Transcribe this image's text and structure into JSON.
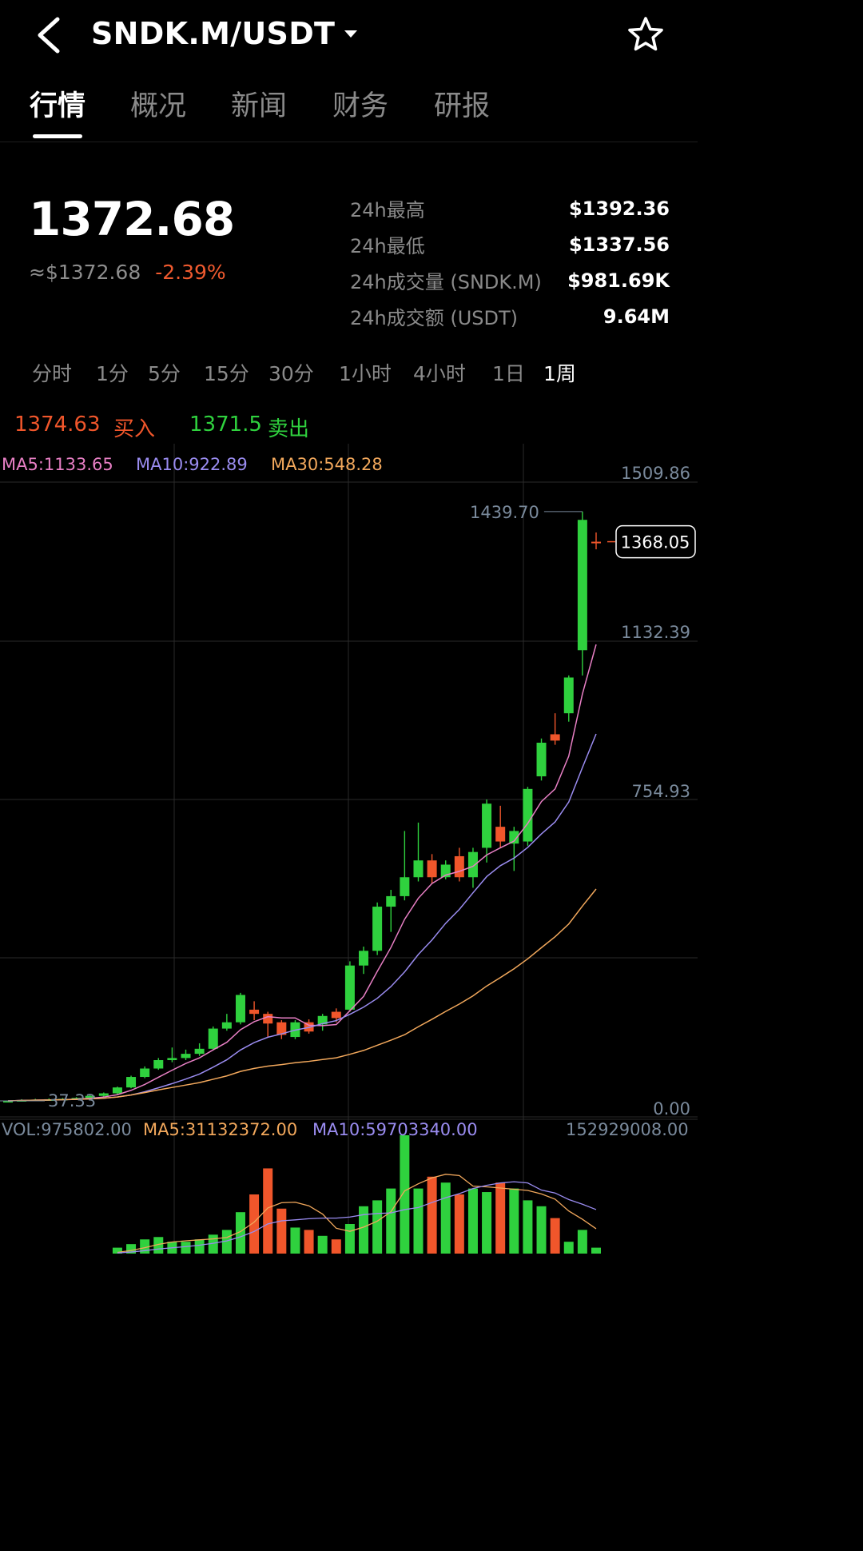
{
  "header": {
    "pair": "SNDK.M/USDT"
  },
  "tabs": [
    {
      "label": "行情",
      "active": true
    },
    {
      "label": "概况",
      "active": false
    },
    {
      "label": "新闻",
      "active": false
    },
    {
      "label": "财务",
      "active": false
    },
    {
      "label": "研报",
      "active": false
    }
  ],
  "price": {
    "last": "1372.68",
    "approx_usd": "≈$1372.68",
    "change_pct": "-2.39%"
  },
  "stats": [
    {
      "label": "24h最高",
      "value": "$1392.36"
    },
    {
      "label": "24h最低",
      "value": "$1337.56"
    },
    {
      "label": "24h成交量 (SNDK.M)",
      "value": "$981.69K"
    },
    {
      "label": "24h成交额 (USDT)",
      "value": "9.64M"
    }
  ],
  "intervals": [
    {
      "label": "分时",
      "active": false
    },
    {
      "label": "1分",
      "active": false
    },
    {
      "label": "5分",
      "active": false
    },
    {
      "label": "15分",
      "active": false
    },
    {
      "label": "30分",
      "active": false
    },
    {
      "label": "1小时",
      "active": false
    },
    {
      "label": "4小时",
      "active": false
    },
    {
      "label": "1日",
      "active": false
    },
    {
      "label": "1周",
      "active": true
    }
  ],
  "orderbook": {
    "bid_price": "1374.63",
    "bid_label": "买入",
    "ask_price": "1371.5",
    "ask_label": "卖出"
  },
  "ma_legend": {
    "ma5": "MA5:1133.65",
    "ma10": "MA10:922.89",
    "ma30": "MA30:548.28"
  },
  "volume_legend": {
    "vol": "VOL:975802.00",
    "ma5": "MA5:31132372.00",
    "ma10": "MA10:59703340.00",
    "max": "152929008.00"
  },
  "colors": {
    "up": "#2fd13e",
    "down": "#f0562b",
    "ma5": "#e77fc4",
    "ma10": "#9a8cf0",
    "ma30": "#f2a85c"
  },
  "chart_data": {
    "type": "candlestick",
    "y_axis_labels": [
      "1509.86",
      "1132.39",
      "754.93",
      "0.00"
    ],
    "high_marker": "1439.70",
    "low_marker": "37.33",
    "current_price_tag": "1368.05",
    "ylim": [
      0,
      1509.86
    ],
    "candles": [
      {
        "o": 37,
        "c": 38,
        "h": 39,
        "l": 36
      },
      {
        "o": 38,
        "c": 40,
        "h": 42,
        "l": 37
      },
      {
        "o": 40,
        "c": 41,
        "h": 43,
        "l": 38
      },
      {
        "o": 41,
        "c": 42,
        "h": 44,
        "l": 39
      },
      {
        "o": 42,
        "c": 43,
        "h": 45,
        "l": 40
      },
      {
        "o": 43,
        "c": 45,
        "h": 47,
        "l": 41
      },
      {
        "o": 45,
        "c": 50,
        "h": 52,
        "l": 43
      },
      {
        "o": 50,
        "c": 56,
        "h": 58,
        "l": 48
      },
      {
        "o": 56,
        "c": 70,
        "h": 72,
        "l": 54
      },
      {
        "o": 70,
        "c": 95,
        "h": 98,
        "l": 68
      },
      {
        "o": 95,
        "c": 115,
        "h": 120,
        "l": 92
      },
      {
        "o": 115,
        "c": 135,
        "h": 140,
        "l": 112
      },
      {
        "o": 135,
        "c": 140,
        "h": 165,
        "l": 130
      },
      {
        "o": 140,
        "c": 150,
        "h": 160,
        "l": 135
      },
      {
        "o": 150,
        "c": 162,
        "h": 175,
        "l": 145
      },
      {
        "o": 162,
        "c": 210,
        "h": 215,
        "l": 158
      },
      {
        "o": 210,
        "c": 225,
        "h": 245,
        "l": 205
      },
      {
        "o": 225,
        "c": 290,
        "h": 295,
        "l": 220
      },
      {
        "o": 255,
        "c": 245,
        "h": 275,
        "l": 230
      },
      {
        "o": 245,
        "c": 222,
        "h": 250,
        "l": 190
      },
      {
        "o": 225,
        "c": 195,
        "h": 230,
        "l": 185
      },
      {
        "o": 190,
        "c": 225,
        "h": 230,
        "l": 185
      },
      {
        "o": 225,
        "c": 203,
        "h": 232,
        "l": 198
      },
      {
        "o": 220,
        "c": 240,
        "h": 245,
        "l": 205
      },
      {
        "o": 250,
        "c": 235,
        "h": 258,
        "l": 225
      },
      {
        "o": 255,
        "c": 360,
        "h": 370,
        "l": 250
      },
      {
        "o": 360,
        "c": 395,
        "h": 405,
        "l": 340
      },
      {
        "o": 395,
        "c": 500,
        "h": 510,
        "l": 385
      },
      {
        "o": 500,
        "c": 525,
        "h": 540,
        "l": 440
      },
      {
        "o": 525,
        "c": 570,
        "h": 680,
        "l": 515
      },
      {
        "o": 570,
        "c": 610,
        "h": 700,
        "l": 560
      },
      {
        "o": 610,
        "c": 570,
        "h": 625,
        "l": 555
      },
      {
        "o": 570,
        "c": 600,
        "h": 610,
        "l": 565
      },
      {
        "o": 620,
        "c": 570,
        "h": 640,
        "l": 560
      },
      {
        "o": 570,
        "c": 630,
        "h": 640,
        "l": 545
      },
      {
        "o": 640,
        "c": 745,
        "h": 755,
        "l": 605
      },
      {
        "o": 690,
        "c": 655,
        "h": 740,
        "l": 640
      },
      {
        "o": 650,
        "c": 680,
        "h": 690,
        "l": 585
      },
      {
        "o": 655,
        "c": 780,
        "h": 785,
        "l": 645
      },
      {
        "o": 810,
        "c": 890,
        "h": 900,
        "l": 800
      },
      {
        "o": 910,
        "c": 895,
        "h": 960,
        "l": 885
      },
      {
        "o": 960,
        "c": 1045,
        "h": 1050,
        "l": 940
      },
      {
        "o": 1110,
        "c": 1420,
        "h": 1439.7,
        "l": 1050
      },
      {
        "o": 1368.05,
        "c": 1368.05,
        "h": 1390,
        "l": 1350
      }
    ],
    "volume_axis_max": "152929008.00"
  }
}
